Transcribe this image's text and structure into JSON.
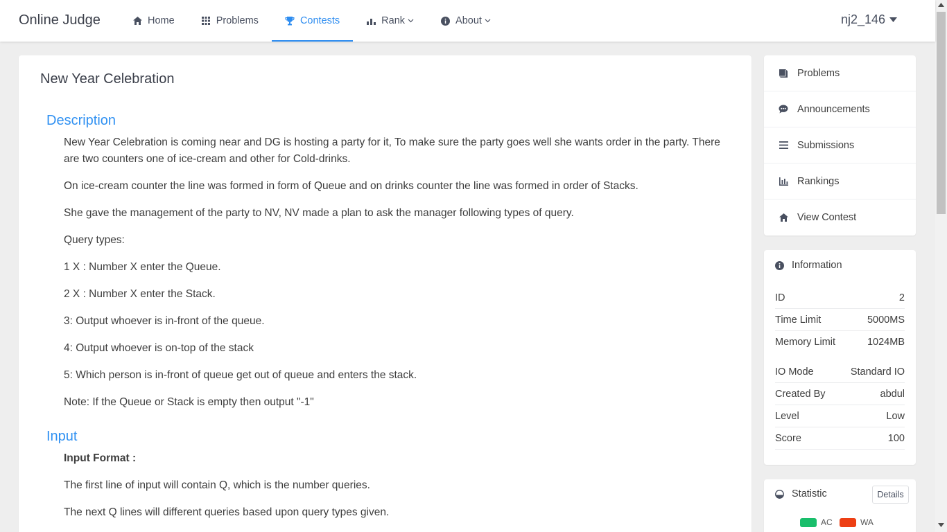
{
  "header": {
    "brand": "Online Judge",
    "nav": [
      {
        "label": "Home",
        "icon": "home-icon"
      },
      {
        "label": "Problems",
        "icon": "grid-icon"
      },
      {
        "label": "Contests",
        "icon": "trophy-icon",
        "active": true
      },
      {
        "label": "Rank",
        "icon": "bar-chart-icon",
        "dropdown": true
      },
      {
        "label": "About",
        "icon": "info-icon",
        "dropdown": true
      }
    ],
    "username": "nj2_146"
  },
  "problem": {
    "title": "New Year Celebration",
    "description_heading": "Description",
    "description": [
      "New Year Celebration is coming near and DG is hosting a party for it, To make sure the party goes well she wants order in the party. There are two counters one of ice-cream and other for Cold-drinks.",
      "On ice-cream counter the line was formed in form of Queue and on drinks counter the line was formed in order of Stacks.",
      "She gave the management of the party to NV, NV made a plan to ask the manager following types of query.",
      "Query types:",
      "1 X : Number X enter the Queue.",
      "2 X : Number X enter the Stack.",
      "3: Output whoever is in-front of the queue.",
      "4: Output whoever is on-top of the stack",
      "5: Which person is in-front of queue get out of queue and enters the stack.",
      "Note: If the Queue or Stack is empty then output \"-1\""
    ],
    "input_heading": "Input",
    "input_format_label": "Input Format :",
    "input": [
      "The first line of input will contain Q, which is the number queries.",
      "The next Q lines will different queries based upon query types given."
    ]
  },
  "sidebar": {
    "menu": [
      {
        "label": "Problems",
        "icon": "book-icon"
      },
      {
        "label": "Announcements",
        "icon": "chat-icon"
      },
      {
        "label": "Submissions",
        "icon": "list-icon"
      },
      {
        "label": "Rankings",
        "icon": "stats-icon"
      },
      {
        "label": "View Contest",
        "icon": "home-icon"
      }
    ],
    "information": {
      "heading": "Information",
      "rows": [
        {
          "key": "ID",
          "value": "2"
        },
        {
          "key": "Time Limit",
          "value": "5000MS"
        },
        {
          "key": "Memory Limit",
          "value": "1024MB"
        },
        {
          "key": "IO Mode",
          "value": "Standard IO"
        },
        {
          "key": "Created By",
          "value": "abdul"
        },
        {
          "key": "Level",
          "value": "Low"
        },
        {
          "key": "Score",
          "value": "100"
        }
      ]
    },
    "statistic": {
      "heading": "Statistic",
      "details_label": "Details",
      "legend": [
        {
          "label": "AC",
          "color": "#19be6b"
        },
        {
          "label": "WA",
          "color": "#ed3f14"
        }
      ]
    }
  },
  "colors": {
    "accent": "#2d8cf0",
    "section_heading": "#3091f2"
  }
}
